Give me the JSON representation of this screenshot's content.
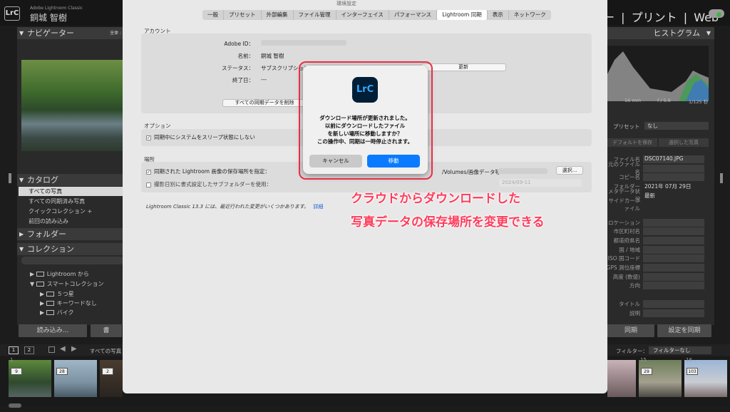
{
  "app": {
    "logo": "LrC",
    "subtitle": "Adobe Lightroom Classic",
    "user": "銅城 智樹",
    "dialog_title": "環境設定"
  },
  "modules": [
    "ー",
    "|",
    "プリント",
    "|",
    "Web"
  ],
  "left": {
    "navigator": "ナビゲーター",
    "navigator_options": "全体 :",
    "catalog": "カタログ",
    "catalog_items": [
      "すべての写真",
      "すべての同期済み写真",
      "クイックコレクション +",
      "前回の読み込み"
    ],
    "folder": "フォルダー",
    "collection": "コレクション",
    "collection_items": [
      "Lightroom から",
      "スマートコレクション",
      "５つ星",
      "キーワードなし",
      "バイク"
    ],
    "import_btn": "読み込み...",
    "export_btn": "書"
  },
  "right": {
    "histogram": "ヒストグラム",
    "focal": "16 mm",
    "aperture": "f / 5.6",
    "shutter": "1/125 秒",
    "preset_label": "プリセット",
    "preset_value": "なし",
    "btn_tabs": [
      "デフォルトを保存",
      "選択した写真"
    ],
    "meta": [
      {
        "label": "ファイル名",
        "value": "DSC07140.JPG"
      },
      {
        "label": "元のファイル名",
        "value": ""
      },
      {
        "label": "コピー名",
        "value": ""
      },
      {
        "label": "フォルダー",
        "value": "2021年 07月 29日"
      },
      {
        "label": "メタデータ状況",
        "value": "最新"
      },
      {
        "label": "サイドカーファイル",
        "value": ""
      },
      {
        "label": "",
        "value": ""
      },
      {
        "label": "ロケーション",
        "value": ""
      },
      {
        "label": "市区町村名",
        "value": ""
      },
      {
        "label": "都道府県名",
        "value": ""
      },
      {
        "label": "国 / 地域",
        "value": ""
      },
      {
        "label": "ISO 国コード",
        "value": ""
      },
      {
        "label": "GPS 測位座標",
        "value": ""
      },
      {
        "label": "高度 (数値)",
        "value": ""
      },
      {
        "label": "方向",
        "value": ""
      },
      {
        "label": "",
        "value": ""
      },
      {
        "label": "タイトル",
        "value": ""
      },
      {
        "label": "説明",
        "value": ""
      }
    ],
    "sync_btn": "同期",
    "settings_btn": "設定を同期",
    "filter_label": "フィルター：",
    "filter_value": "フィルターなし"
  },
  "prefs": {
    "tabs": [
      "一般",
      "プリセット",
      "外部編集",
      "ファイル管理",
      "インターフェイス",
      "パフォーマンス",
      "Lightroom 同期",
      "表示",
      "ネットワーク"
    ],
    "selected_tab": "Lightroom 同期",
    "account_title": "アカウント",
    "adobe_id_label": "Adobe ID：",
    "name_label": "名前：",
    "name_value": "銅城 智樹",
    "status_label": "ステータス：",
    "status_value": "サブスクリプション",
    "end_label": "終了日：",
    "end_value": "---",
    "update_btn": "更新",
    "delete_sync_btn": "すべての同期データを削除",
    "options_title": "オプション",
    "no_sleep": "同期中にシステムをスリープ状態にしない",
    "location_title": "場所",
    "specify_location": "同期された Lightroom 画像の保存場所を指定：",
    "location_path": "/Volumes/画像データ等",
    "choose_btn": "選択...",
    "subfolder_label": "撮影日別に書式設定したサブフォルダーを使用：",
    "subfolder_value": "2024/09-11",
    "footer_note": "Lightroom Classic 13.3 には、最近行われた変更がいくつかあります。",
    "footer_link": "詳細"
  },
  "modal": {
    "icon": "LrC",
    "lines": [
      "ダウンロード場所が更新されました。",
      "以前にダウンロードしたファイル",
      "を新しい場所に移動しますか？",
      "この操作中、同期は一時停止されます。"
    ],
    "cancel": "キャンセル",
    "move": "移動"
  },
  "annotation": {
    "line1": "クラウドからダウンロードした",
    "line2": "写真データの保存場所を変更できる"
  },
  "filmstrip": {
    "pages": [
      "1",
      "2"
    ],
    "source": "すべての写真",
    "thumbs": [
      {
        "num": "1",
        "badge": "9"
      },
      {
        "num": "",
        "badge": "28"
      },
      {
        "num": "",
        "badge": "2"
      },
      {
        "num": "15",
        "badge": "29"
      },
      {
        "num": "16",
        "badge": "103"
      }
    ]
  }
}
